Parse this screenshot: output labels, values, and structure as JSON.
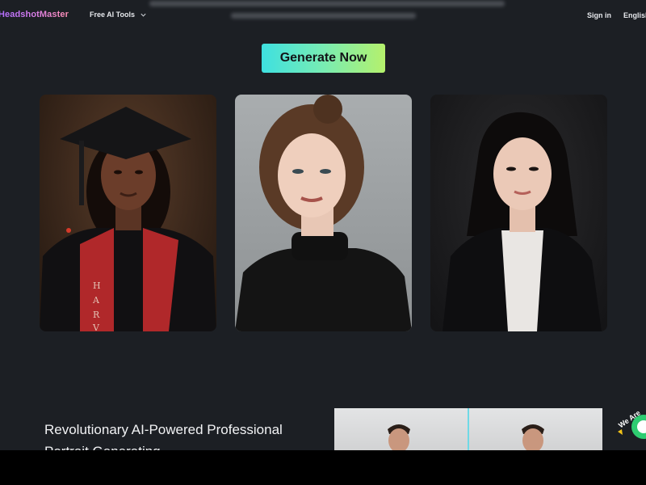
{
  "header": {
    "logo_text": "HeadshotMaster",
    "nav_tools_label": "Free AI Tools",
    "sign_in_label": "Sign in",
    "language_label": "English"
  },
  "hero": {
    "cta_label": "Generate Now"
  },
  "gallery": {
    "portraits": [
      {
        "name": "graduation-portrait",
        "gown_lettering": "HARV"
      },
      {
        "name": "woman-black-turtleneck-portrait"
      },
      {
        "name": "woman-black-blazer-portrait"
      }
    ]
  },
  "feature": {
    "title": "Revolutionary AI-Powered Professional Portrait Generating"
  },
  "badge": {
    "text": "We Are"
  },
  "colors": {
    "background": "#1c1f24",
    "cta_gradient_start": "#3ee0e0",
    "cta_gradient_end": "#b5f16c",
    "logo_gradient_start": "#b06cff",
    "logo_gradient_end": "#ff8fb5"
  }
}
